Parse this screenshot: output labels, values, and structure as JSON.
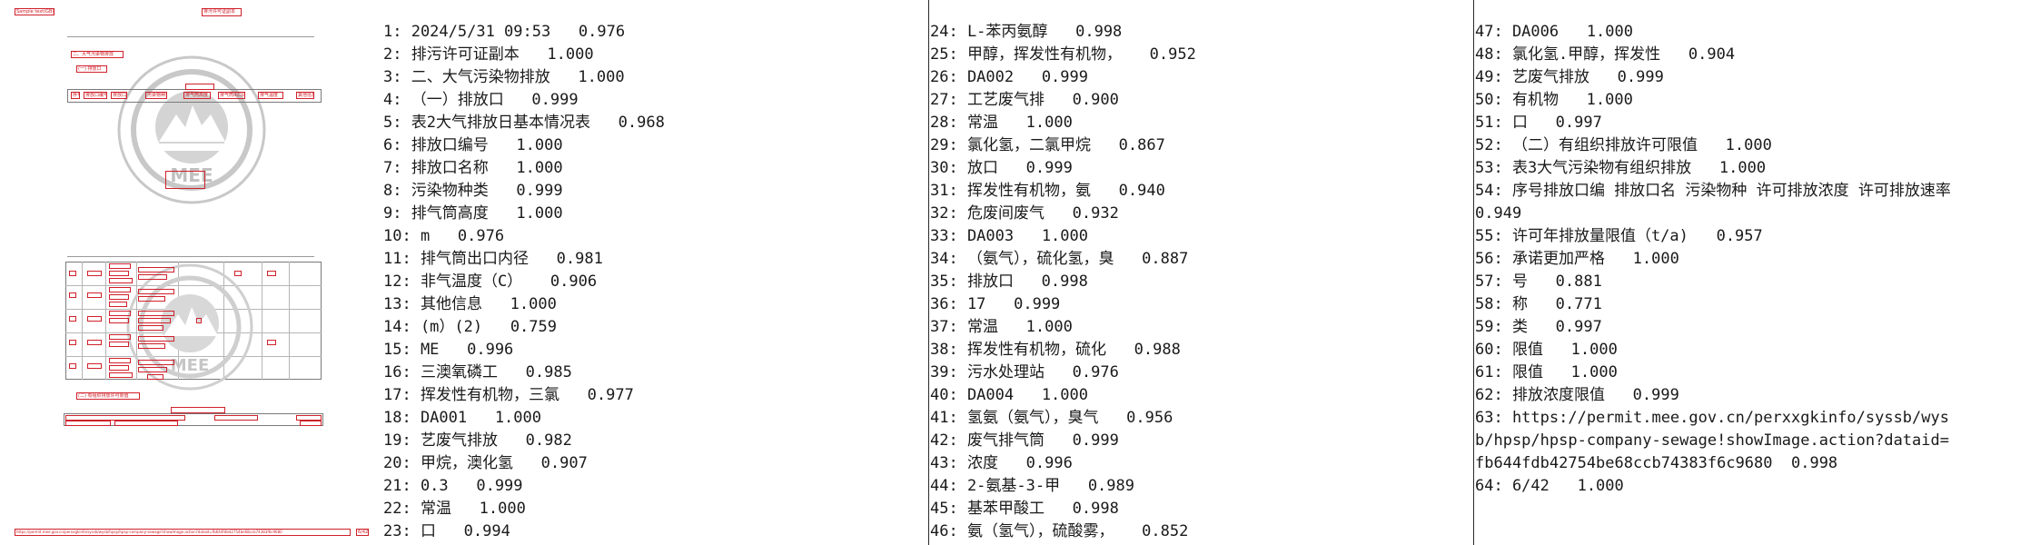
{
  "thumbnail": {
    "header_label_left": "Sample text(GB)",
    "header_label_center": "排污许可证副本",
    "section_label_1": "二、大气污染物排放",
    "section_label_2": "(一) 排放口",
    "table_headers": [
      "序号",
      "排放口编号",
      "排放口名称",
      "污染物种类",
      "排气筒高度",
      "排气筒出口内径",
      "排气温度",
      "其他信息"
    ],
    "section_label_3": "(二) 有组织排放许可限值",
    "seal_text": "MEE",
    "footer_url": "https://permit.mee.gov.cn/perxxgkinfo/syssb/wysb/hpsp/hpsp-company-sewage!showImage.action?dataid=fb644fdb42754be68ccb74383f6c9680",
    "footer_page": "6/42"
  },
  "columns": [
    {
      "lines": [
        "1: 2024/5/31 09:53   0.976",
        "2: 排污许可证副本   1.000",
        "3: 二、大气污染物排放   1.000",
        "4: （一）排放口   0.999",
        "5: 表2大气排放日基本情况表   0.968",
        "6: 排放口编号   1.000",
        "7: 排放口名称   1.000",
        "8: 污染物种类   0.999",
        "9: 排气筒高度   1.000",
        "10: m   0.976",
        "11: 排气筒出口内径   0.981",
        "12: 非气温度（C）   0.906",
        "13: 其他信息   1.000",
        "14: (m）(2)   0.759",
        "15: ME   0.996",
        "16: 三澳氧磷工   0.985",
        "17: 挥发性有机物，三氯   0.977",
        "18: DA001   1.000",
        "19: 艺废气排放   0.982",
        "20: 甲烷，澳化氢   0.907",
        "21: 0.3   0.999",
        "22: 常温   1.000",
        "23: 口   0.994"
      ]
    },
    {
      "lines": [
        "24: L-苯丙氨醇   0.998",
        "25: 甲醇，挥发性有机物，   0.952",
        "26: DA002   0.999",
        "27: 工艺废气排   0.900",
        "28: 常温   1.000",
        "29: 氯化氢，二氯甲烷   0.867",
        "30: 放口   0.999",
        "31: 挥发性有机物，氨   0.940",
        "32: 危废间废气   0.932",
        "33: DA003   1.000",
        "34: （氨气），硫化氢，臭   0.887",
        "35: 排放口   0.998",
        "36: 17   0.999",
        "37: 常温   1.000",
        "38: 挥发性有机物，硫化   0.988",
        "39: 污水处理站   0.976",
        "40: DA004   1.000",
        "41: 氢氨（氨气），臭气   0.956",
        "42: 废气排气筒   0.999",
        "43: 浓度   0.996",
        "44: 2-氨基-3-甲   0.989",
        "45: 基苯甲酸工   0.998",
        "46: 氨（氢气），硫酸雾，   0.852"
      ]
    },
    {
      "lines": [
        "47: DA006   1.000",
        "48: 氯化氢.甲醇，挥发性   0.904",
        "49: 艺废气排放   0.999",
        "50: 有机物   1.000",
        "51: 口   0.997",
        "52: （二）有组织排放许可限值   1.000",
        "53: 表3大气污染物有组织排放   1.000",
        "54: 序号排放口编 排放口名 污染物种 许可排放浓度 许可排放速率  0.949",
        "55: 许可年排放量限值（t/a)   0.957",
        "56: 承诺更加严格   1.000",
        "57: 号   0.881",
        "58: 称   0.771",
        "59: 类   0.997",
        "60: 限值   1.000",
        "61: 限值   1.000",
        "62: 排放浓度限值   0.999",
        "63: https://permit.mee.gov.cn/perxxgkinfo/syssb/wysb/hpsp/hpsp-company-sewage!showImage.action?dataid=fb644fdb42754be68ccb74383f6c9680  0.998",
        "64: 6/42   1.000"
      ]
    }
  ]
}
